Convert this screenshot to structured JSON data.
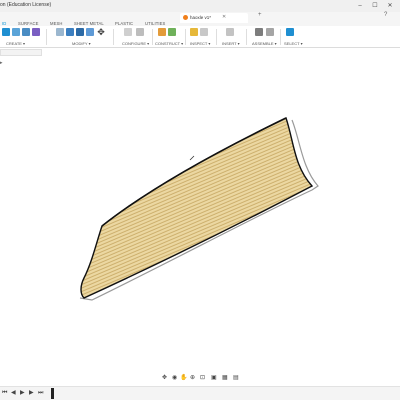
{
  "window": {
    "title": "on (Education License)",
    "minimize": "–",
    "maximize": "☐",
    "close": "✕"
  },
  "workspace_tabs": [
    {
      "label": "ID",
      "active": true
    },
    {
      "label": "SURFACE",
      "active": false
    },
    {
      "label": "MESH",
      "active": false
    },
    {
      "label": "SHEET METAL",
      "active": false
    },
    {
      "label": "PLASTIC",
      "active": false
    },
    {
      "label": "UTILITIES",
      "active": false
    }
  ],
  "document_tab": {
    "name": "haoxle v1*",
    "close": "✕",
    "new_tab": "+",
    "user": "?"
  },
  "toolbar": {
    "groups": [
      {
        "label": "CREATE ▾"
      },
      {
        "label": "MODIFY ▾"
      },
      {
        "label": "CONFIGURE ▾"
      },
      {
        "label": "CONSTRUCT ▾"
      },
      {
        "label": "INSPECT ▾"
      },
      {
        "label": "INSERT ▾"
      },
      {
        "label": "ASSEMBLE ▾"
      },
      {
        "label": "SELECT ▾"
      }
    ]
  },
  "browser": {
    "pin": "▸"
  },
  "navbar": {
    "icons": [
      "orbit-icon",
      "pan-icon",
      "look-at-icon",
      "zoom-icon",
      "fit-icon",
      "display-settings-icon",
      "grid-icon",
      "viewports-icon"
    ]
  },
  "timeline": {
    "buttons": [
      "⏮",
      "◀",
      "▶",
      "▶",
      "⏭"
    ]
  },
  "colors": {
    "accent": "#0696d7",
    "part_fill": "#e8d39a",
    "part_stripe": "#c7a862",
    "part_edge": "#111111",
    "doc_icon": "#f07f1b"
  }
}
